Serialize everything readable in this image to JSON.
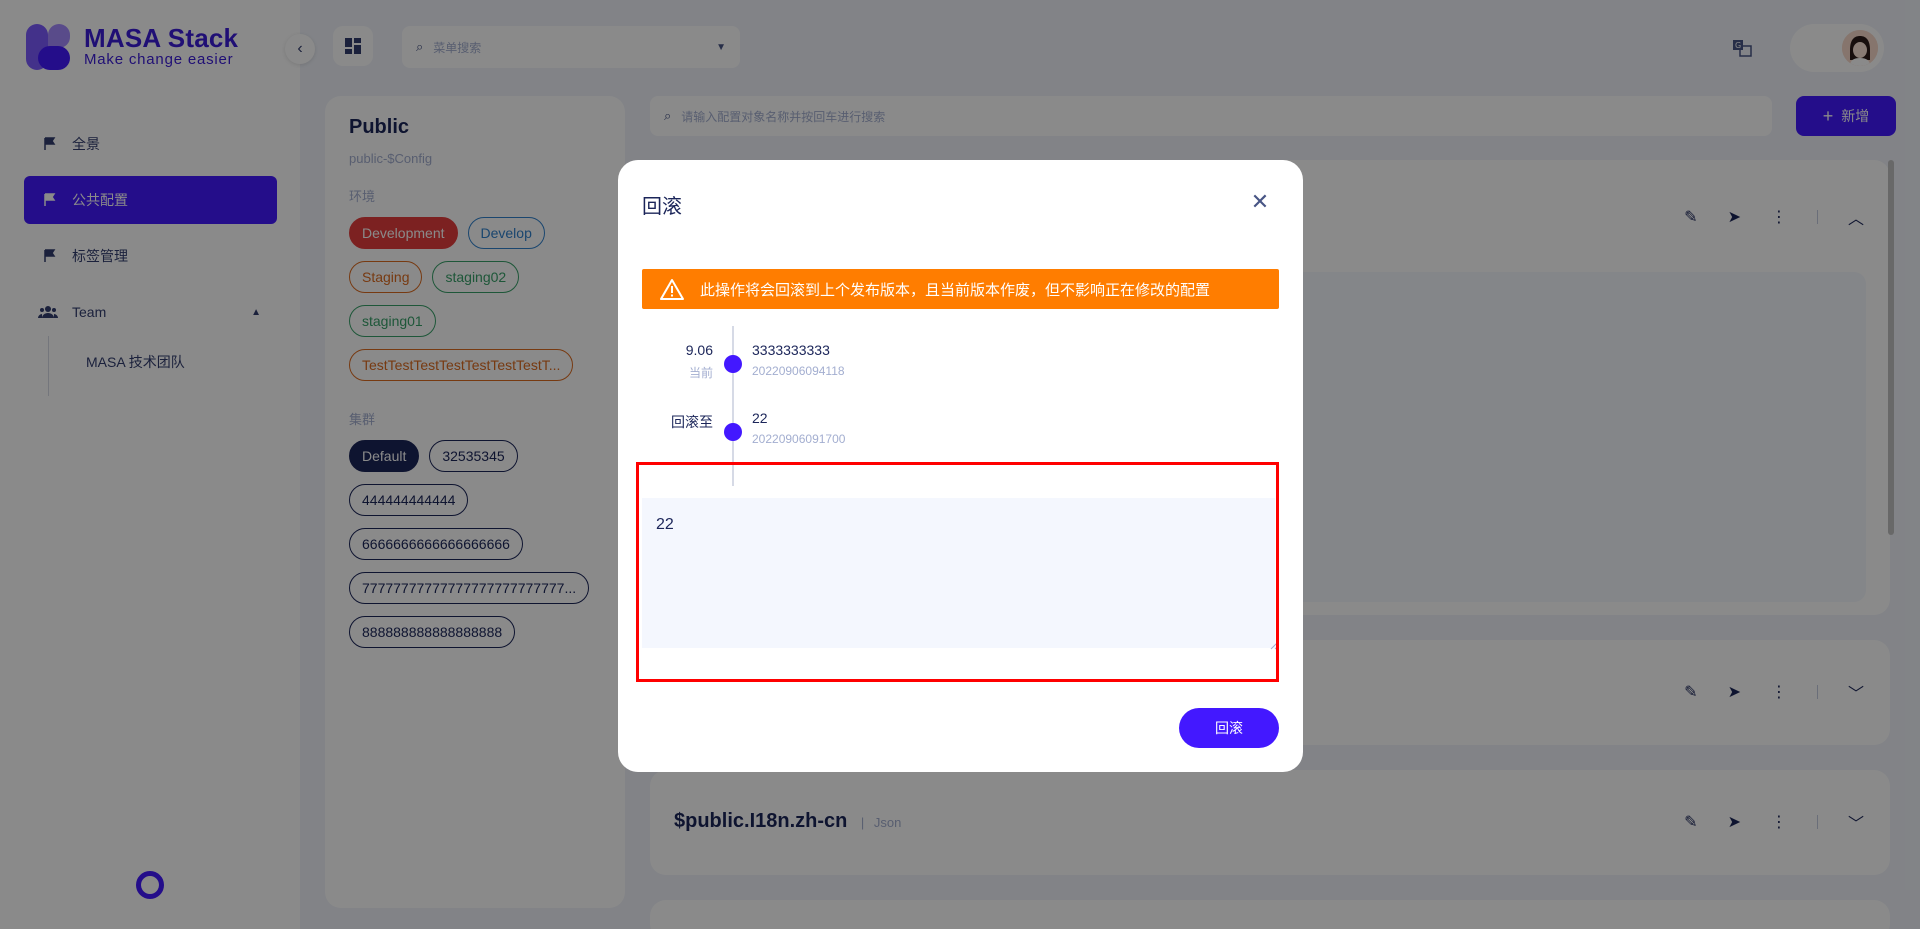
{
  "app": {
    "logo_title": "MASA Stack",
    "logo_subtitle": "Make change easier",
    "brand_color": "#4318ff"
  },
  "sidebar": {
    "items": [
      {
        "label": "全景",
        "icon": "flag-icon",
        "active": false
      },
      {
        "label": "公共配置",
        "icon": "flag-icon",
        "active": true
      },
      {
        "label": "标签管理",
        "icon": "flag-icon",
        "active": false
      }
    ],
    "group": {
      "label": "Team",
      "icon": "team-icon",
      "expanded": true,
      "children": [
        {
          "label": "MASA 技术团队"
        }
      ]
    }
  },
  "topbar": {
    "menu_search_placeholder": "菜单搜索",
    "icons": [
      "grid-icon",
      "translate-icon",
      "bell-icon",
      "avatar"
    ]
  },
  "panel": {
    "title": "Public",
    "subtitle": "public-$Config",
    "env_label": "环境",
    "environments": [
      {
        "label": "Development",
        "style": "dev"
      },
      {
        "label": "Develop",
        "style": "blue"
      },
      {
        "label": "Staging",
        "style": "orange"
      },
      {
        "label": "staging02",
        "style": "green"
      },
      {
        "label": "staging01",
        "style": "green"
      },
      {
        "label": "TestTestTestTestTestTestTestT...",
        "style": "orange"
      }
    ],
    "cluster_label": "集群",
    "clusters": [
      {
        "label": "Default",
        "style": "darkfill"
      },
      {
        "label": "32535345",
        "style": "dark"
      },
      {
        "label": "444444444444",
        "style": "dark"
      },
      {
        "label": "6666666666666666666",
        "style": "dark"
      },
      {
        "label": "77777777777777777777777777...",
        "style": "dark"
      },
      {
        "label": "888888888888888888",
        "style": "dark"
      }
    ]
  },
  "main": {
    "config_search_placeholder": "请输入配置对象名称并按回车进行搜索",
    "add_label": "新增",
    "cards": [
      {
        "title": "",
        "type": ""
      },
      {
        "title": "",
        "type": ""
      },
      {
        "title": "$public.I18n.zh-cn",
        "type": "Json"
      }
    ]
  },
  "dialog": {
    "title": "回滚",
    "warning": "此操作将会回滚到上个发布版本，且当前版本作废，但不影响正在修改的配置",
    "timeline": [
      {
        "left_main": "9.06",
        "left_sub": "当前",
        "name": "3333333333",
        "version": "20220906094118"
      },
      {
        "left_main": "回滚至",
        "left_sub": "",
        "name": "22",
        "version": "20220906091700"
      }
    ],
    "content": "22",
    "rollback_label": "回滚"
  }
}
